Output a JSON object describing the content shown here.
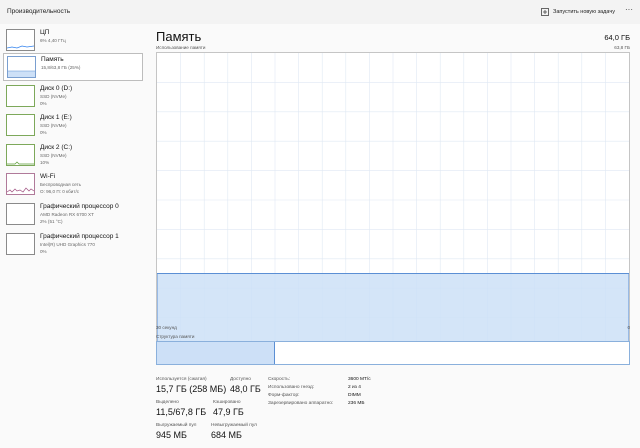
{
  "app_title": "Производительность",
  "run_task_label": "Запустить новую задачу",
  "more_label": "···",
  "accent": "#1e6fd9",
  "sidebar": [
    {
      "name": "ЦП",
      "sub1": "6% 4,40 ГГц",
      "sub2": "",
      "icon": "cpu-mini-graph"
    },
    {
      "name": "Память",
      "sub1": "15,8/63,8 ГБ (25%)",
      "sub2": "",
      "icon": "memory-mini-graph"
    },
    {
      "name": "Диск 0 (D:)",
      "sub1": "SSD (NVMe)",
      "sub2": "0%",
      "icon": "disk-mini-graph"
    },
    {
      "name": "Диск 1 (E:)",
      "sub1": "SSD (NVMe)",
      "sub2": "0%",
      "icon": "disk-mini-graph"
    },
    {
      "name": "Диск 2 (C:)",
      "sub1": "SSD (NVMe)",
      "sub2": "10%",
      "icon": "disk-mini-graph"
    },
    {
      "name": "Wi-Fi",
      "sub1": "Беспроводная сеть",
      "sub2": "О: 96,0 П: 0 кбит/с",
      "icon": "network-mini-graph"
    },
    {
      "name": "Графический процессор 0",
      "sub1": "AMD Radeon RX 6700 XT",
      "sub2": "2% (51 °C)",
      "icon": "gpu-mini-graph"
    },
    {
      "name": "Графический процессор 1",
      "sub1": "Intel(R) UHD Graphics 770",
      "sub2": "0%",
      "icon": "gpu-mini-graph"
    }
  ],
  "main": {
    "title": "Память",
    "total": "64,0 ГБ",
    "usage_label": "Использование памяти",
    "usage_max": "63,8 ГБ",
    "axis_left": "30 секунд",
    "axis_right": "0",
    "struct_label": "Структура памяти",
    "memory_usage_fraction": 0.25
  },
  "stats": {
    "in_use_label": "Используется (сжатая)",
    "in_use_value": "15,7 ГБ (258 МБ)",
    "available_label": "Доступно",
    "available_value": "48,0 ГБ",
    "committed_label": "Выделено",
    "committed_value": "11,5/67,8 ГБ",
    "cached_label": "Кэшировано",
    "cached_value": "47,9 ГБ",
    "paged_label": "Выгружаемый пул",
    "paged_value": "945 МБ",
    "nonpaged_label": "Невыгружаемый пул",
    "nonpaged_value": "684 МБ"
  },
  "props": [
    {
      "label": "Скорость:",
      "value": "3600 МТ/с"
    },
    {
      "label": "Использовано гнезд:",
      "value": "2 из 4"
    },
    {
      "label": "Форм-фактор:",
      "value": "DIMM"
    },
    {
      "label": "Зарезервировано аппаратно:",
      "value": "236 МБ"
    }
  ]
}
